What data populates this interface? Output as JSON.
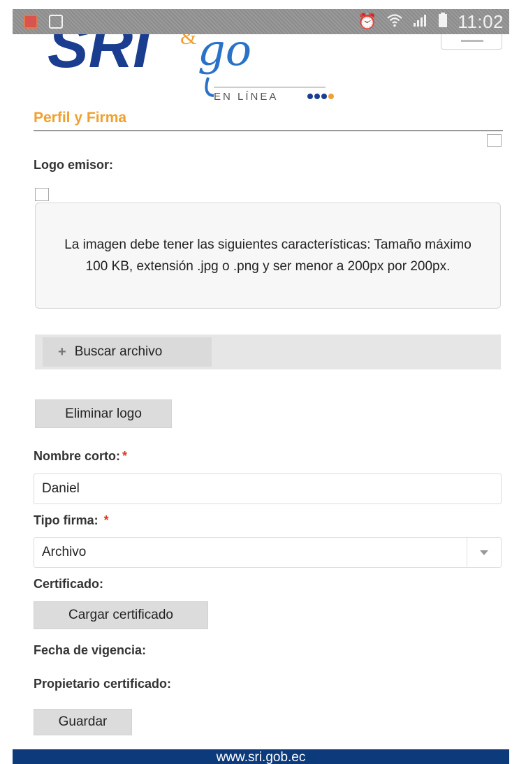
{
  "status_bar": {
    "time": "11:02",
    "icons": [
      "notes-app-icon",
      "gallery-icon",
      "alarm-icon",
      "wifi-icon",
      "signal-icon",
      "battery-icon"
    ]
  },
  "header": {
    "logo": {
      "text_main": "SRI",
      "text_amp": "&",
      "text_script": "go",
      "text_sub": "EN LÍNEA",
      "colors": {
        "main": "#1b3d8f",
        "amp": "#f0a030",
        "script": "#2a72c8"
      }
    }
  },
  "form": {
    "section_title": "Perfil y Firma",
    "logo_label": "Logo emisor:",
    "image_info": "La imagen debe tener las siguientes características: Tamaño máximo 100 KB, extensión .jpg o .png y ser menor a 200px por 200px.",
    "search_file_label": "Buscar archivo",
    "delete_logo_label": "Eliminar logo",
    "short_name_label": "Nombre corto:",
    "short_name_required": "*",
    "short_name_value": "Daniel",
    "sign_type_label": "Tipo firma:",
    "sign_type_required": "*",
    "sign_type_value": "Archivo",
    "certificate_label": "Certificado:",
    "load_certificate_label": "Cargar certificado",
    "validity_label": "Fecha de vigencia:",
    "owner_label": "Propietario certificado:",
    "save_label": "Guardar"
  },
  "footer": {
    "url": "www.sri.gob.ec"
  },
  "colors": {
    "accent": "#f0a030",
    "required": "#d9381e",
    "footer_bg": "#0c3a7a"
  }
}
